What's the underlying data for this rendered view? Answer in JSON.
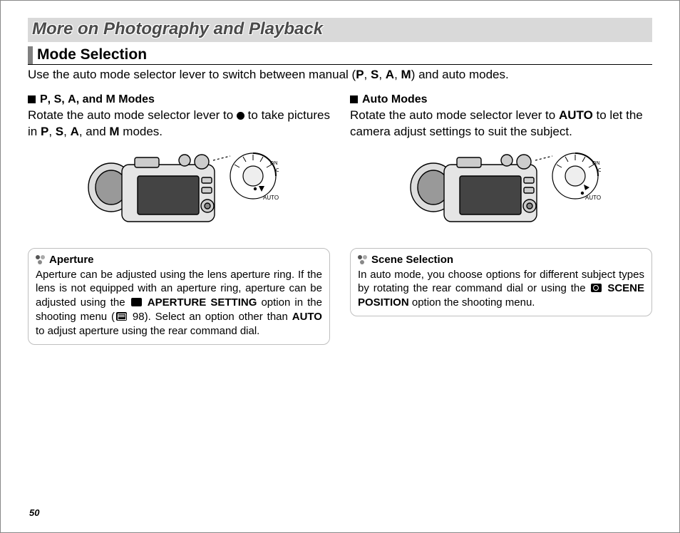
{
  "chapter_title": "More on Photography and Playback",
  "section_title": "Mode Selection",
  "intro_pre": "Use the auto mode selector lever to switch between manual (",
  "intro_modes": [
    "P",
    "S",
    "A",
    "M"
  ],
  "intro_post": ") and auto modes.",
  "left": {
    "heading_modes": [
      "P",
      "S",
      "A",
      "M"
    ],
    "heading_suffix": " Modes",
    "body_pre": "Rotate the auto mode selector lever to ",
    "body_post_1": " to take pictures in ",
    "body_modes": [
      "P",
      "S",
      "A",
      "M"
    ],
    "body_post_2": " modes.",
    "note_title": "Aperture",
    "note_body_1": "Aperture can be adjusted using the lens aperture ring. If the lens is not equipped with an aperture ring, aperture can be adjusted using the ",
    "note_bold_1": "APERTURE SETTING",
    "note_body_2": " option in the shooting menu (",
    "note_pageref": " 98).  Select an option other than ",
    "note_bold_2": "AUTO",
    "note_body_3": " to adjust aperture using the rear command dial."
  },
  "right": {
    "heading": "Auto Modes",
    "body_pre": "Rotate the auto mode selector lever to ",
    "body_bold": "AUTO",
    "body_post": " to let the camera adjust settings to suit the subject.",
    "note_title": "Scene Selection",
    "note_body_1": "In auto mode, you choose options for different sub­ject types by rotating the rear command dial or using the ",
    "note_bold_1": "SCENE POSITION",
    "note_body_2": " option the shooting menu."
  },
  "page_number": "50"
}
